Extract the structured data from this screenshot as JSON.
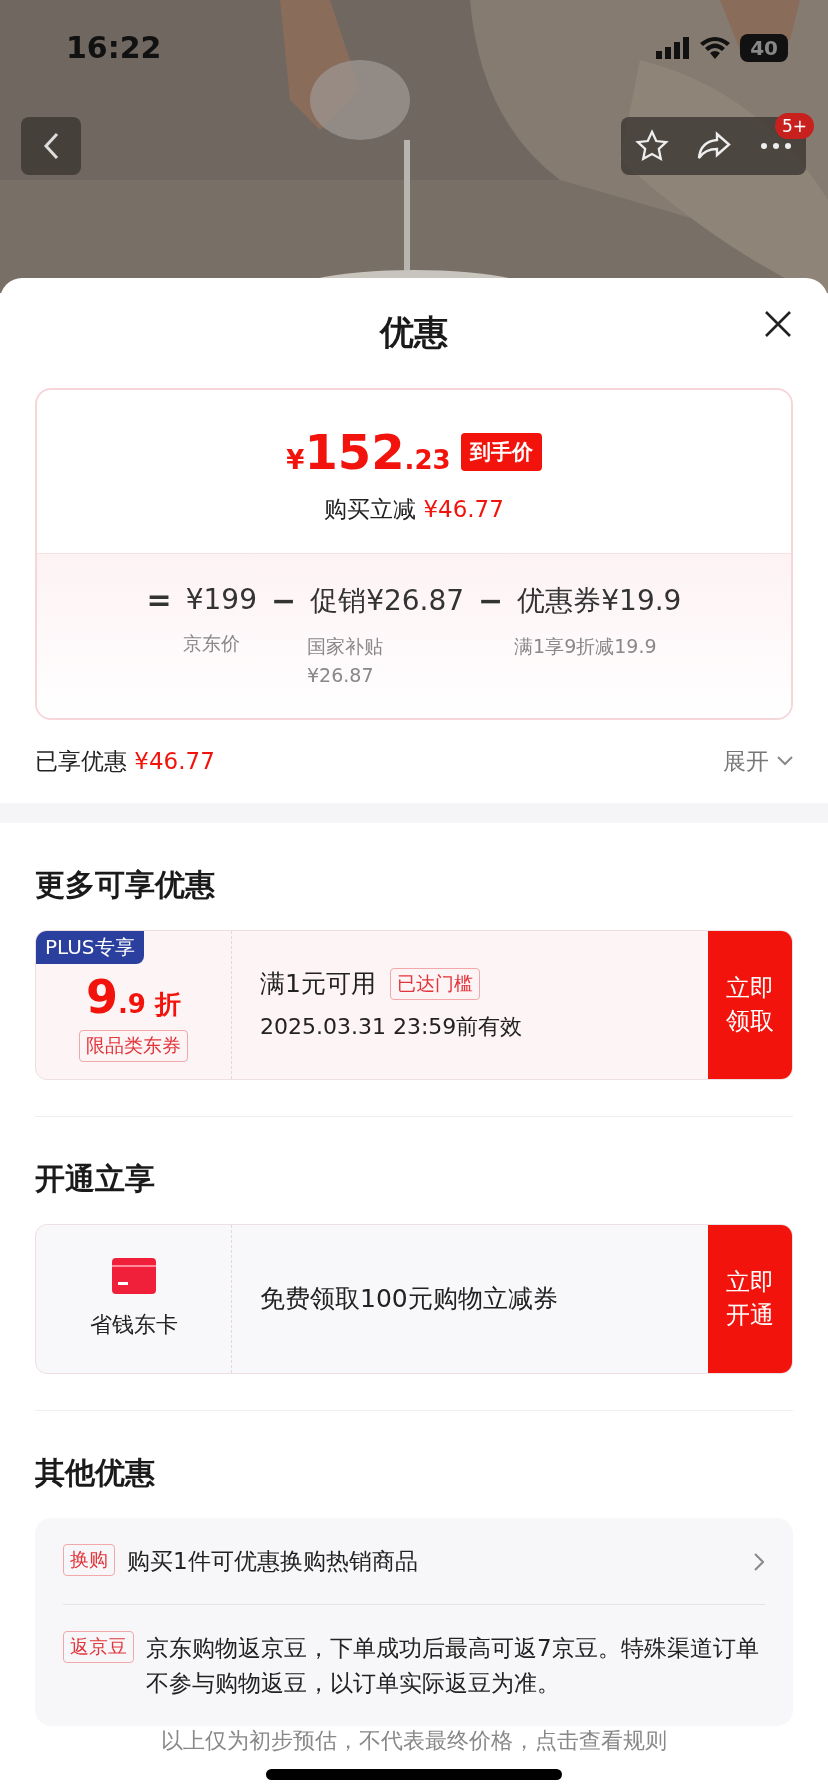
{
  "status_bar": {
    "time": "16:22",
    "battery": "40"
  },
  "nav": {
    "badge": "5+"
  },
  "sheet": {
    "title": "优惠",
    "price_card": {
      "currency": "¥",
      "integer": "152",
      "decimal": ".23",
      "final_label": "到手价",
      "saving_label": "购买立减",
      "saving_amount": "¥46.77",
      "breakdown": [
        {
          "operator": "=",
          "amount": "¥199",
          "notes": [
            "京东价"
          ]
        },
        {
          "operator": "−",
          "label": "促销",
          "amount": "¥26.87",
          "notes": [
            "国家补贴",
            "¥26.87"
          ]
        },
        {
          "operator": "−",
          "label": "优惠券",
          "amount": "¥19.9",
          "notes": [
            "满1享9折减19.9"
          ]
        }
      ]
    },
    "enjoyed": {
      "label": "已享优惠",
      "amount": "¥46.77",
      "expand": "展开"
    },
    "more_offers": {
      "heading": "更多可享优惠",
      "coupons": [
        {
          "badge": "PLUS专享",
          "value_int": "9",
          "value_dec": ".9",
          "unit": "折",
          "scope": "限品类东券",
          "condition": "满1元可用",
          "status_tag": "已达门槛",
          "validity": "2025.03.31 23:59前有效",
          "action": "立即领取"
        }
      ]
    },
    "open_section": {
      "heading": "开通立享",
      "card": {
        "name": "省钱东卡",
        "description": "免费领取100元购物立减券",
        "action": "立即开通"
      }
    },
    "other": {
      "heading": "其他优惠",
      "items": [
        {
          "kind": "link",
          "tag": "换购",
          "text": "购买1件可优惠换购热销商品"
        },
        {
          "kind": "info",
          "tag": "返京豆",
          "text": "京东购物返京豆，下单成功后最高可返7京豆。特殊渠道订单不参与购物返豆，以订单实际返豆为准。"
        }
      ]
    },
    "footer": "以上仅为初步预估，不代表最终价格，点击查看规则"
  }
}
